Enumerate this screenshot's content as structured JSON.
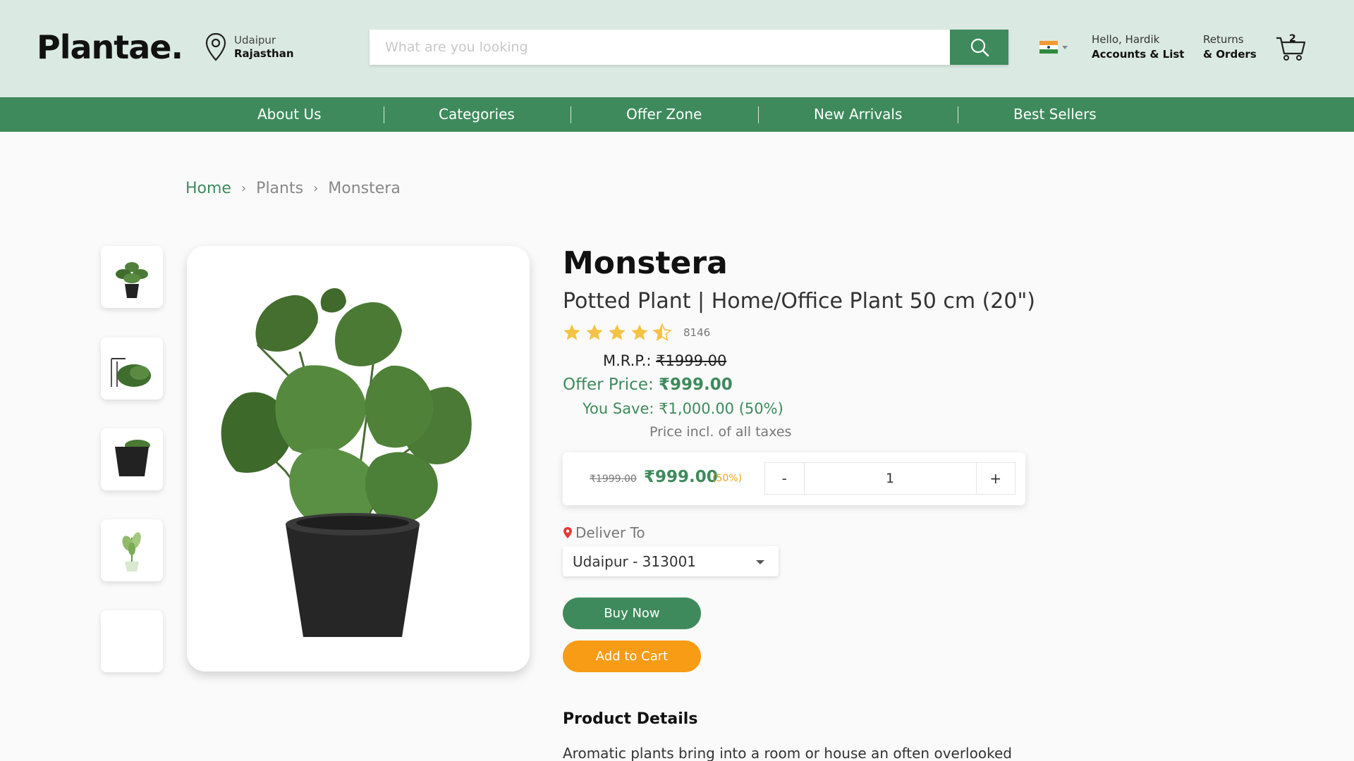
{
  "header": {
    "logo": "Plantae.",
    "location_city": "Udaipur",
    "location_state": "Rajasthan",
    "search_placeholder": "What are you looking",
    "greeting": "Hello, Hardik",
    "accounts_label": "Accounts & List",
    "returns_label": "Returns",
    "orders_label": "& Orders",
    "cart_count": "2"
  },
  "nav": {
    "items": [
      "About Us",
      "Categories",
      "Offer Zone",
      "New Arrivals",
      "Best Sellers"
    ]
  },
  "breadcrumb": [
    "Home",
    "Plants",
    "Monstera"
  ],
  "product": {
    "title": "Monstera",
    "subtitle": "Potted Plant | Home/Office Plant 50 cm (20\")",
    "rating": 4.5,
    "rating_count": "8146",
    "mrp_label": "M.R.P.:",
    "mrp_value": "₹1999.00",
    "offer_label": "Offer Price:",
    "offer_value": "₹999.00",
    "save_text": "You Save: ₹1,000.00 (50%)",
    "tax_note": "Price incl. of all taxes",
    "qty_old_price": "₹1999.00",
    "qty_price": "₹999.00",
    "qty_pct": "(50%)",
    "qty_minus": "-",
    "qty_plus": "+",
    "qty_value": "1",
    "deliver_label": "Deliver To",
    "deliver_option": "Udaipur - 313001",
    "buy_label": "Buy Now",
    "cart_label": "Add to Cart",
    "details_title": "Product Details",
    "details_text": "Aromatic plants bring into a room or house an often overlooked"
  },
  "colors": {
    "brand_green": "#3e8a5c",
    "header_bg": "#dbe9e3",
    "accent_orange": "#f89b15",
    "star": "#f5c344"
  }
}
